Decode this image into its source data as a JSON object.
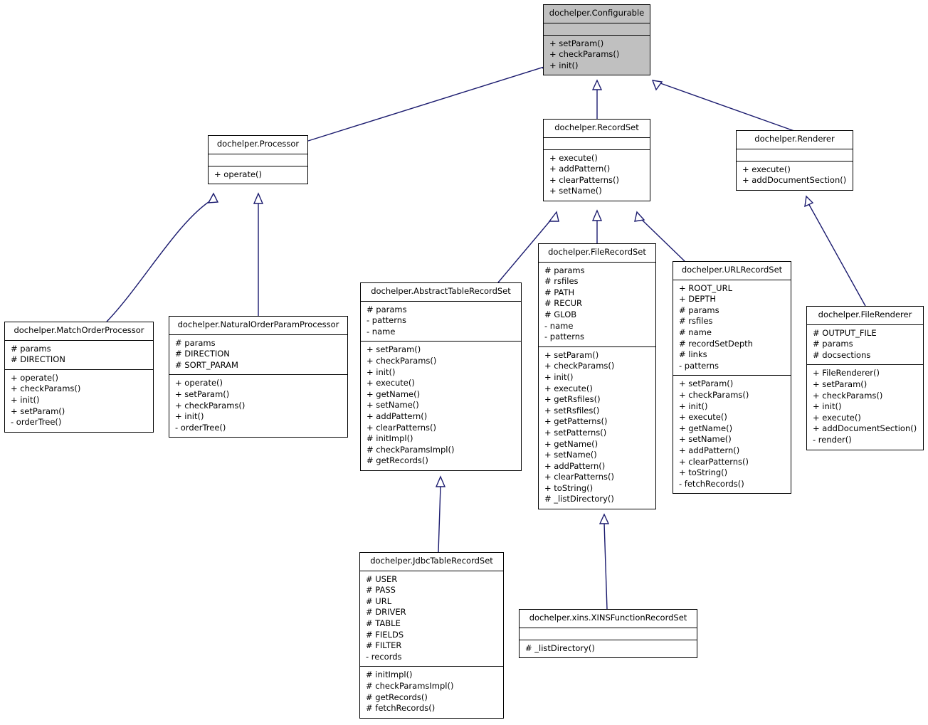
{
  "diagram": {
    "kind": "uml-class-diagram",
    "edge_color": "#1a1a6e",
    "highlight_color": "#c0c0c0",
    "border_color": "#000000",
    "background": "#ffffff"
  },
  "classes": [
    {
      "id": "configurable",
      "name": "dochelper.Configurable",
      "highlighted": true,
      "attributes": [],
      "operations": [
        "+ setParam()",
        "+ checkParams()",
        "+ init()"
      ]
    },
    {
      "id": "processor",
      "name": "dochelper.Processor",
      "highlighted": false,
      "attributes": [],
      "operations": [
        "+ operate()"
      ]
    },
    {
      "id": "recordset",
      "name": "dochelper.RecordSet",
      "highlighted": false,
      "attributes": [],
      "operations": [
        "+ execute()",
        "+ addPattern()",
        "+ clearPatterns()",
        "+ setName()"
      ]
    },
    {
      "id": "renderer",
      "name": "dochelper.Renderer",
      "highlighted": false,
      "attributes": [],
      "operations": [
        "+ execute()",
        "+ addDocumentSection()"
      ]
    },
    {
      "id": "matchorderprocessor",
      "name": "dochelper.MatchOrderProcessor",
      "highlighted": false,
      "attributes": [
        "# params",
        "# DIRECTION"
      ],
      "operations": [
        "+ operate()",
        "+ checkParams()",
        "+ init()",
        "+ setParam()",
        "- orderTree()"
      ]
    },
    {
      "id": "naturalorderparamprocessor",
      "name": "dochelper.NaturalOrderParamProcessor",
      "highlighted": false,
      "attributes": [
        "# params",
        "# DIRECTION",
        "# SORT_PARAM"
      ],
      "operations": [
        "+ operate()",
        "+ setParam()",
        "+ checkParams()",
        "+ init()",
        "- orderTree()"
      ]
    },
    {
      "id": "abstracttablerecordset",
      "name": "dochelper.AbstractTableRecordSet",
      "highlighted": false,
      "attributes": [
        "# params",
        "- patterns",
        "- name"
      ],
      "operations": [
        "+ setParam()",
        "+ checkParams()",
        "+ init()",
        "+ execute()",
        "+ getName()",
        "+ setName()",
        "+ addPattern()",
        "+ clearPatterns()",
        "# initImpl()",
        "# checkParamsImpl()",
        "# getRecords()"
      ]
    },
    {
      "id": "filerecordset",
      "name": "dochelper.FileRecordSet",
      "highlighted": false,
      "attributes": [
        "# params",
        "# rsfiles",
        "# PATH",
        "# RECUR",
        "# GLOB",
        "- name",
        "- patterns"
      ],
      "operations": [
        "+ setParam()",
        "+ checkParams()",
        "+ init()",
        "+ execute()",
        "+ getRsfiles()",
        "+ setRsfiles()",
        "+ getPatterns()",
        "+ setPatterns()",
        "+ getName()",
        "+ setName()",
        "+ addPattern()",
        "+ clearPatterns()",
        "+ toString()",
        "# _listDirectory()"
      ]
    },
    {
      "id": "urlrecordset",
      "name": "dochelper.URLRecordSet",
      "highlighted": false,
      "attributes": [
        "+ ROOT_URL",
        "+ DEPTH",
        "# params",
        "# rsfiles",
        "# name",
        "# recordSetDepth",
        "# links",
        "- patterns"
      ],
      "operations": [
        "+ setParam()",
        "+ checkParams()",
        "+ init()",
        "+ execute()",
        "+ getName()",
        "+ setName()",
        "+ addPattern()",
        "+ clearPatterns()",
        "+ toString()",
        "- fetchRecords()"
      ]
    },
    {
      "id": "filerenderer",
      "name": "dochelper.FileRenderer",
      "highlighted": false,
      "attributes": [
        "# OUTPUT_FILE",
        "# params",
        "# docsections"
      ],
      "operations": [
        "+ FileRenderer()",
        "+ setParam()",
        "+ checkParams()",
        "+ init()",
        "+ execute()",
        "+ addDocumentSection()",
        "- render()"
      ]
    },
    {
      "id": "jdbctablerecordset",
      "name": "dochelper.JdbcTableRecordSet",
      "highlighted": false,
      "attributes": [
        "# USER",
        "# PASS",
        "# URL",
        "# DRIVER",
        "# TABLE",
        "# FIELDS",
        "# FILTER",
        "- records"
      ],
      "operations": [
        "# initImpl()",
        "# checkParamsImpl()",
        "# getRecords()",
        "# fetchRecords()"
      ]
    },
    {
      "id": "xinsfunctionrecordset",
      "name": "dochelper.xins.XINSFunctionRecordSet",
      "highlighted": false,
      "attributes": [],
      "operations": [
        "# _listDirectory()"
      ]
    }
  ],
  "inheritance_edges": [
    {
      "from": "processor",
      "to": "configurable"
    },
    {
      "from": "recordset",
      "to": "configurable"
    },
    {
      "from": "renderer",
      "to": "configurable"
    },
    {
      "from": "matchorderprocessor",
      "to": "processor"
    },
    {
      "from": "naturalorderparamprocessor",
      "to": "processor"
    },
    {
      "from": "abstracttablerecordset",
      "to": "recordset"
    },
    {
      "from": "filerecordset",
      "to": "recordset"
    },
    {
      "from": "urlrecordset",
      "to": "recordset"
    },
    {
      "from": "filerenderer",
      "to": "renderer"
    },
    {
      "from": "jdbctablerecordset",
      "to": "abstracttablerecordset"
    },
    {
      "from": "xinsfunctionrecordset",
      "to": "filerecordset"
    }
  ]
}
